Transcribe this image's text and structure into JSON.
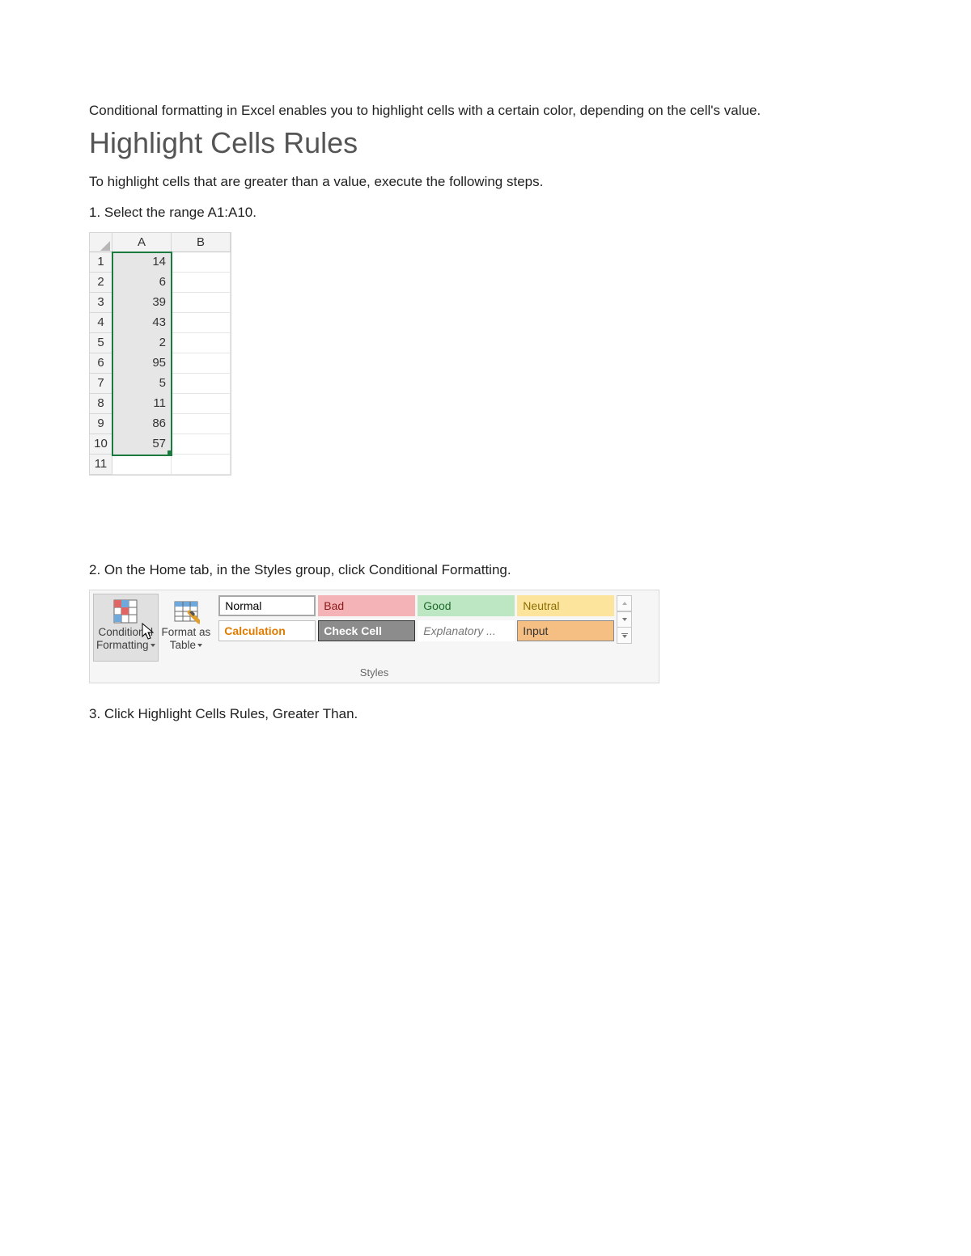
{
  "intro": "Conditional formatting in Excel enables you to highlight cells with a certain color, depending on the cell's value.",
  "heading": "Highlight Cells Rules",
  "subtext": "To highlight cells that are greater than a value, execute the following steps.",
  "step1": "1. Select the range A1:A10.",
  "step2": "2. On the Home tab, in the Styles group, click Conditional Formatting.",
  "step3": "3. Click Highlight Cells Rules, Greater Than.",
  "grid": {
    "columns": [
      "A",
      "B"
    ],
    "rows": [
      {
        "n": "1",
        "A": "14",
        "B": ""
      },
      {
        "n": "2",
        "A": "6",
        "B": ""
      },
      {
        "n": "3",
        "A": "39",
        "B": ""
      },
      {
        "n": "4",
        "A": "43",
        "B": ""
      },
      {
        "n": "5",
        "A": "2",
        "B": ""
      },
      {
        "n": "6",
        "A": "95",
        "B": ""
      },
      {
        "n": "7",
        "A": "5",
        "B": ""
      },
      {
        "n": "8",
        "A": "11",
        "B": ""
      },
      {
        "n": "9",
        "A": "86",
        "B": ""
      },
      {
        "n": "10",
        "A": "57",
        "B": ""
      },
      {
        "n": "11",
        "A": "",
        "B": ""
      }
    ]
  },
  "ribbon": {
    "conditional_line1": "Conditional",
    "conditional_line2": "Formatting",
    "format_as_line1": "Format as",
    "format_as_line2": "Table",
    "styles": {
      "normal": "Normal",
      "bad": "Bad",
      "good": "Good",
      "neutral": "Neutral",
      "calculation": "Calculation",
      "check_cell": "Check Cell",
      "explanatory": "Explanatory ...",
      "input": "Input"
    },
    "group_label": "Styles"
  }
}
